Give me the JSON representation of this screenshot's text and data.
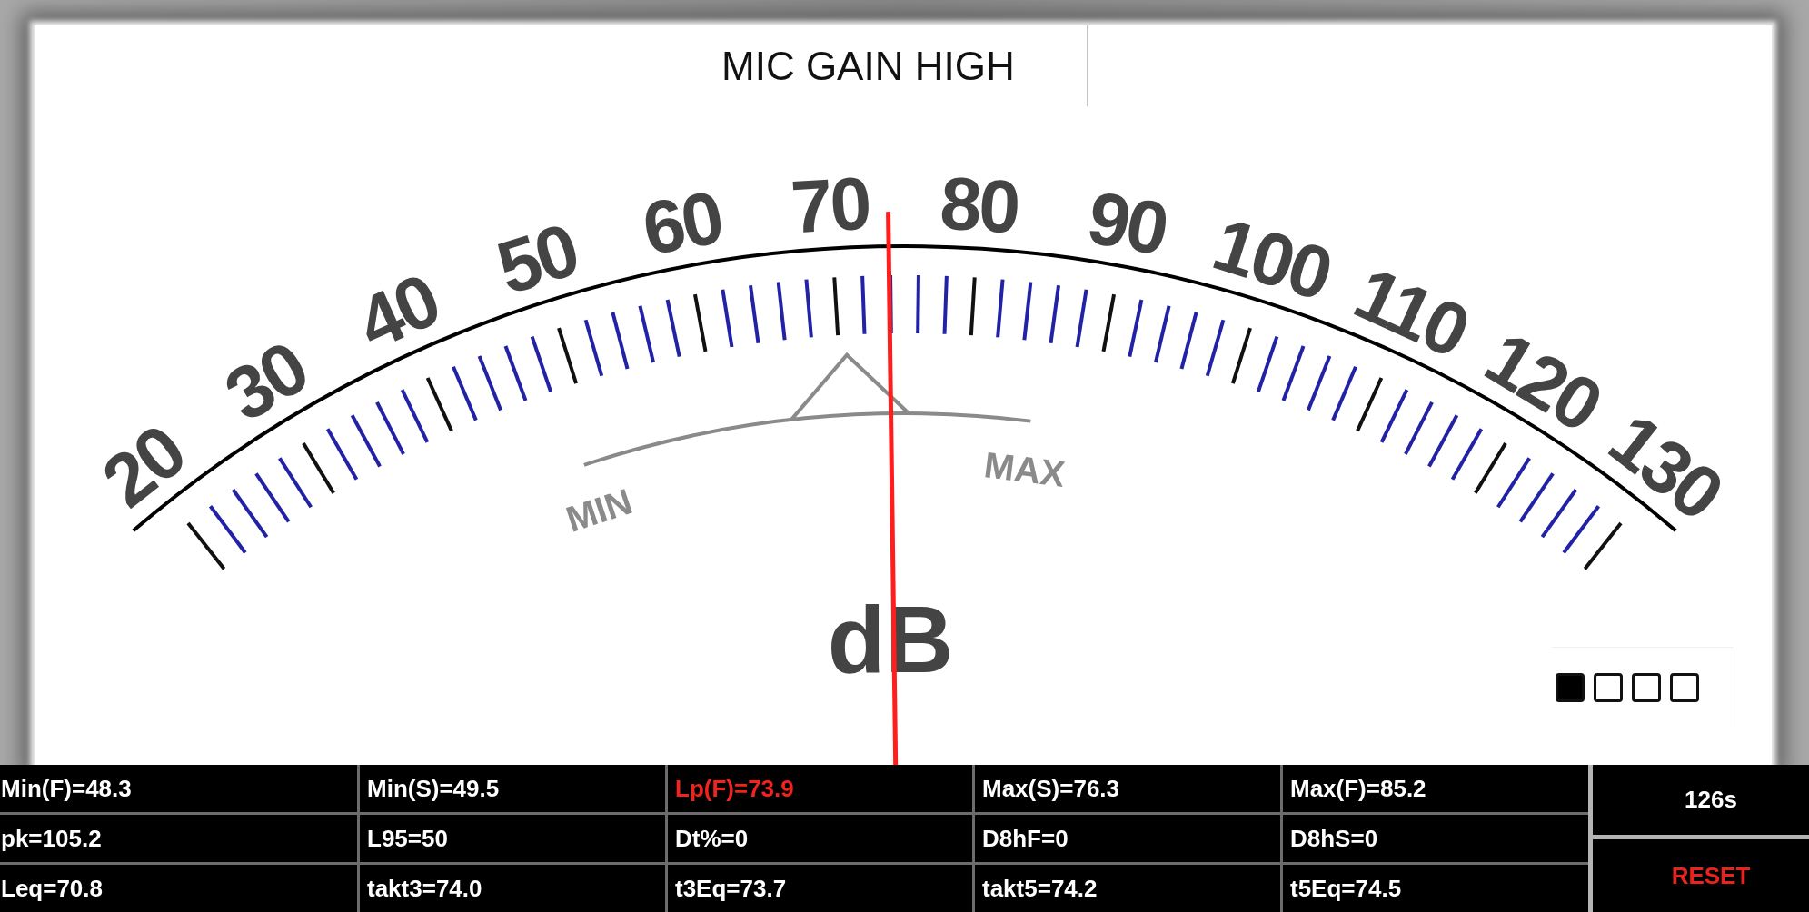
{
  "status_label": "MIC GAIN HIGH",
  "meter": {
    "scale_labels": [
      "20",
      "30",
      "40",
      "50",
      "60",
      "70",
      "80",
      "90",
      "100",
      "110",
      "120",
      "130"
    ],
    "unit": "dB",
    "needle": {
      "level": 0.49
    },
    "range_indicator": {
      "min_label": "MIN",
      "max_label": "MAX",
      "level": 0.6
    }
  },
  "mode_indicator": [
    {
      "selected": true
    },
    {
      "selected": false
    },
    {
      "selected": false
    },
    {
      "selected": false
    }
  ],
  "readings": [
    {
      "cells": [
        {
          "text": "Min(F)=48.3",
          "highlighted": false
        },
        {
          "text": "Min(S)=49.5",
          "highlighted": false
        },
        {
          "text": "Lp(F)=73.9",
          "highlighted": true
        },
        {
          "text": "Max(S)=76.3",
          "highlighted": false
        },
        {
          "text": "Max(F)=85.2",
          "highlighted": false
        }
      ]
    },
    {
      "cells": [
        {
          "text": "pk=105.2",
          "highlighted": false
        },
        {
          "text": "L95=50",
          "highlighted": false
        },
        {
          "text": "Dt%=0",
          "highlighted": false
        },
        {
          "text": "D8hF=0",
          "highlighted": false
        },
        {
          "text": "D8hS=0",
          "highlighted": false
        }
      ]
    },
    {
      "cells": [
        {
          "text": "Leq=70.8",
          "highlighted": false
        },
        {
          "text": "takt3=74.0",
          "highlighted": false
        },
        {
          "text": "t3Eq=73.7",
          "highlighted": false
        },
        {
          "text": "takt5=74.2",
          "highlighted": false
        },
        {
          "text": "t5Eq=74.5",
          "highlighted": false
        }
      ]
    }
  ],
  "elapsed_time": "126s",
  "reset_button": {
    "label": "RESET"
  }
}
